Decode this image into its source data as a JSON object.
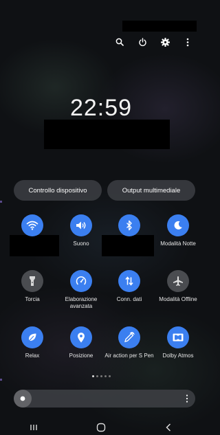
{
  "status_bar": {},
  "clock": {
    "time": "22:59"
  },
  "quick_buttons": {
    "device_control": "Controllo dispositivo",
    "media_output": "Output multimediale"
  },
  "tiles": [
    {
      "id": "wifi",
      "label": "",
      "state": "on",
      "icon": "wifi-icon"
    },
    {
      "id": "sound",
      "label": "Suono",
      "state": "on",
      "icon": "volume-icon"
    },
    {
      "id": "bluetooth",
      "label": "",
      "state": "on",
      "icon": "bluetooth-icon"
    },
    {
      "id": "night-mode",
      "label": "Modalità Notte",
      "state": "on",
      "icon": "moon-icon"
    },
    {
      "id": "torch",
      "label": "Torcia",
      "state": "off",
      "icon": "flashlight-icon"
    },
    {
      "id": "advanced-processing",
      "label": "Elaborazione avanzata",
      "state": "on",
      "icon": "speedometer-icon"
    },
    {
      "id": "data",
      "label": "Conn. dati",
      "state": "on",
      "icon": "data-arrows-icon"
    },
    {
      "id": "airplane",
      "label": "Modalità Offline",
      "state": "off",
      "icon": "airplane-icon"
    },
    {
      "id": "relax",
      "label": "Relax",
      "state": "on",
      "icon": "leaf-icon"
    },
    {
      "id": "location",
      "label": "Posizione",
      "state": "on",
      "icon": "location-pin-icon"
    },
    {
      "id": "air-action",
      "label": "Air action per S Pen",
      "state": "on",
      "icon": "pen-icon"
    },
    {
      "id": "dolby",
      "label": "Dolby Atmos",
      "state": "on",
      "icon": "dolby-icon"
    }
  ],
  "page_indicator": {
    "pages": 5,
    "active": 1
  },
  "brightness": {
    "level": 0.05
  },
  "colors": {
    "accent": "#3b7ff0",
    "tile_off": "#4a4c50",
    "background": "#0f1114"
  }
}
